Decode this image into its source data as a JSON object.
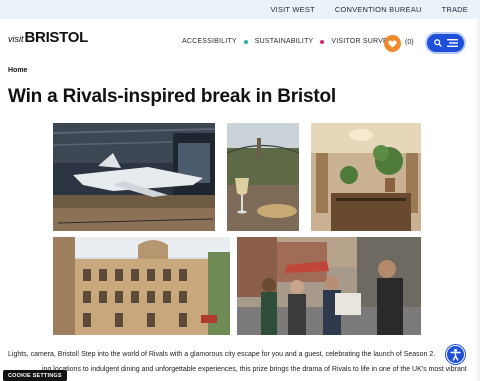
{
  "topbar": {
    "links": [
      "VISIT WEST",
      "CONVENTION BUREAU",
      "TRADE"
    ]
  },
  "logo": {
    "visit": "visit",
    "bristol": "BRISTOL"
  },
  "nav": {
    "items": [
      "ACCESSIBILITY",
      "SUSTAINABILITY",
      "VISITOR SURVEY"
    ],
    "dot_colors": [
      "#27b3a8",
      "#d6267d"
    ]
  },
  "favourites": {
    "count": "(0)"
  },
  "breadcrumb": "Home",
  "page_title": "Win a Rivals-inspired break in Bristol",
  "intro_line1": "Lights, camera, Bristol! Step into the world of Rivals with a glamorous city escape for you and a guest, celebrating the launch of Season 2.",
  "intro_line2": "ing locations to indulgent dining and unforgettable experiences, this prize brings the drama of Rivals to life in one of the UK's most vibrant",
  "cookie": "COOKIE SETTINGS",
  "colors": {
    "accent": "#1d4fd8",
    "heart": "#f08a2f"
  },
  "icons": [
    "heart-icon",
    "search-icon",
    "menu-icon",
    "accessibility-icon"
  ]
}
